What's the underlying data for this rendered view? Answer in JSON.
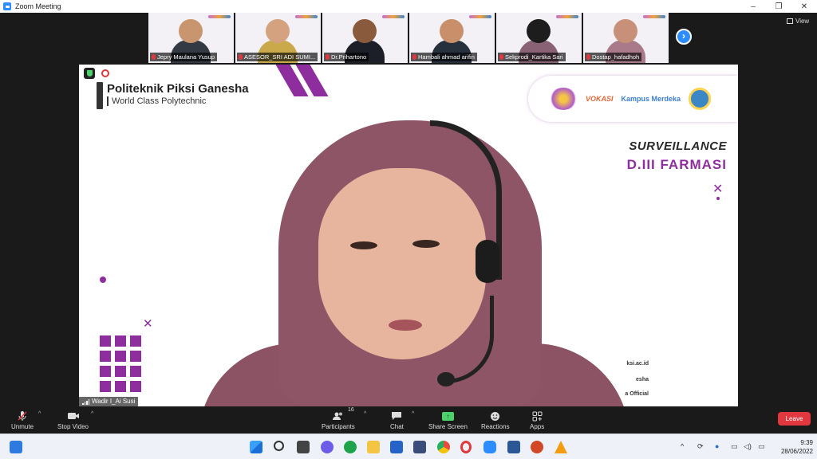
{
  "window": {
    "title": "Zoom Meeting",
    "controls": [
      "–",
      "❐",
      "✕"
    ]
  },
  "view_button": {
    "label": "View"
  },
  "thumbnails": [
    {
      "name": "Jepry Maulana Yusup",
      "muted": true,
      "skin": "#c9956e",
      "clothes": "#333a44"
    },
    {
      "name": "ASESOR_SRI ADI SUMI...",
      "muted": true,
      "skin": "#d4a27e",
      "clothes": "#c9a94a"
    },
    {
      "name": "Dr.Prihartono",
      "muted": true,
      "skin": "#8a5a3c",
      "clothes": "#1d1f28"
    },
    {
      "name": "Hambali ahmad arifin",
      "muted": true,
      "skin": "#c98f6a",
      "clothes": "#27303d"
    },
    {
      "name": "Sekprodi_Kartika Sari",
      "muted": true,
      "skin": "#1d1d1d",
      "clothes": "#8a6275"
    },
    {
      "name": "Dostap_hafadhoh",
      "muted": true,
      "skin": "#c89078",
      "clothes": "#a87a8a"
    }
  ],
  "next_page_icon": "chevron-right-icon",
  "speaker": {
    "name": "Wadir I_Ai Susi",
    "background": {
      "org_name": "Politeknik Piksi Ganesha",
      "org_tagline": "World Class Polytechnic",
      "sponsor_1": "VOKASI",
      "sponsor_2": "Kampus Merdeka",
      "heading_1": "SURVEILLANCE",
      "heading_2": "D.III FARMASI",
      "contact_1": "ksi.ac.id",
      "contact_2": "esha",
      "contact_3": "a Official"
    }
  },
  "toolbar": {
    "unmute": "Unmute",
    "stop_video": "Stop Video",
    "participants": "Participants",
    "participants_count": "16",
    "chat": "Chat",
    "share_screen": "Share Screen",
    "reactions": "Reactions",
    "apps": "Apps",
    "leave": "Leave"
  },
  "taskbar": {
    "time": "9:39",
    "date": "28/06/2022"
  },
  "colors": {
    "zoom_blue": "#2d8cff",
    "leave_red": "#e0383e",
    "share_green": "#4dd26b",
    "brand_purple": "#8e2e9e"
  }
}
